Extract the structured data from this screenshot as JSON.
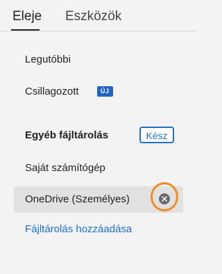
{
  "tabs": [
    {
      "label": "Eleje",
      "active": true
    },
    {
      "label": "Eszközök",
      "active": false
    }
  ],
  "nav": {
    "recent_label": "Legutóbbi",
    "starred_label": "Csillagozott",
    "starred_badge": "ÚJ"
  },
  "other_storage": {
    "title": "Egyéb fájltárolás",
    "done_label": "Kész",
    "items": [
      {
        "label": "Saját számítógép",
        "selected": false
      },
      {
        "label": "OneDrive (Személyes)",
        "selected": true,
        "action_icon": "close-circle-icon"
      }
    ],
    "add_link": "Fájltárolás hozzáadása"
  },
  "colors": {
    "accent": "#1d6fc7",
    "badge": "#1f63c9",
    "highlight_ring": "#f08a24",
    "selected_row": "#e1e1e1",
    "background": "#f3f3f3"
  }
}
